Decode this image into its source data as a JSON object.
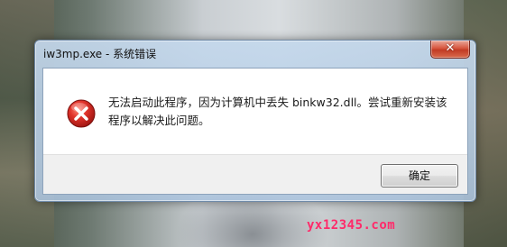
{
  "window": {
    "title": "iw3mp.exe - 系统错误",
    "close_glyph": "✕"
  },
  "dialog": {
    "icon": "error-icon",
    "message": "无法启动此程序，因为计算机中丢失 binkw32.dll。尝试重新安装该程序以解决此问题。",
    "ok_label": "确定"
  },
  "watermark": {
    "text": "yx12345.com"
  },
  "colors": {
    "error_red": "#d2232a",
    "watermark": "#ff2a6a"
  }
}
